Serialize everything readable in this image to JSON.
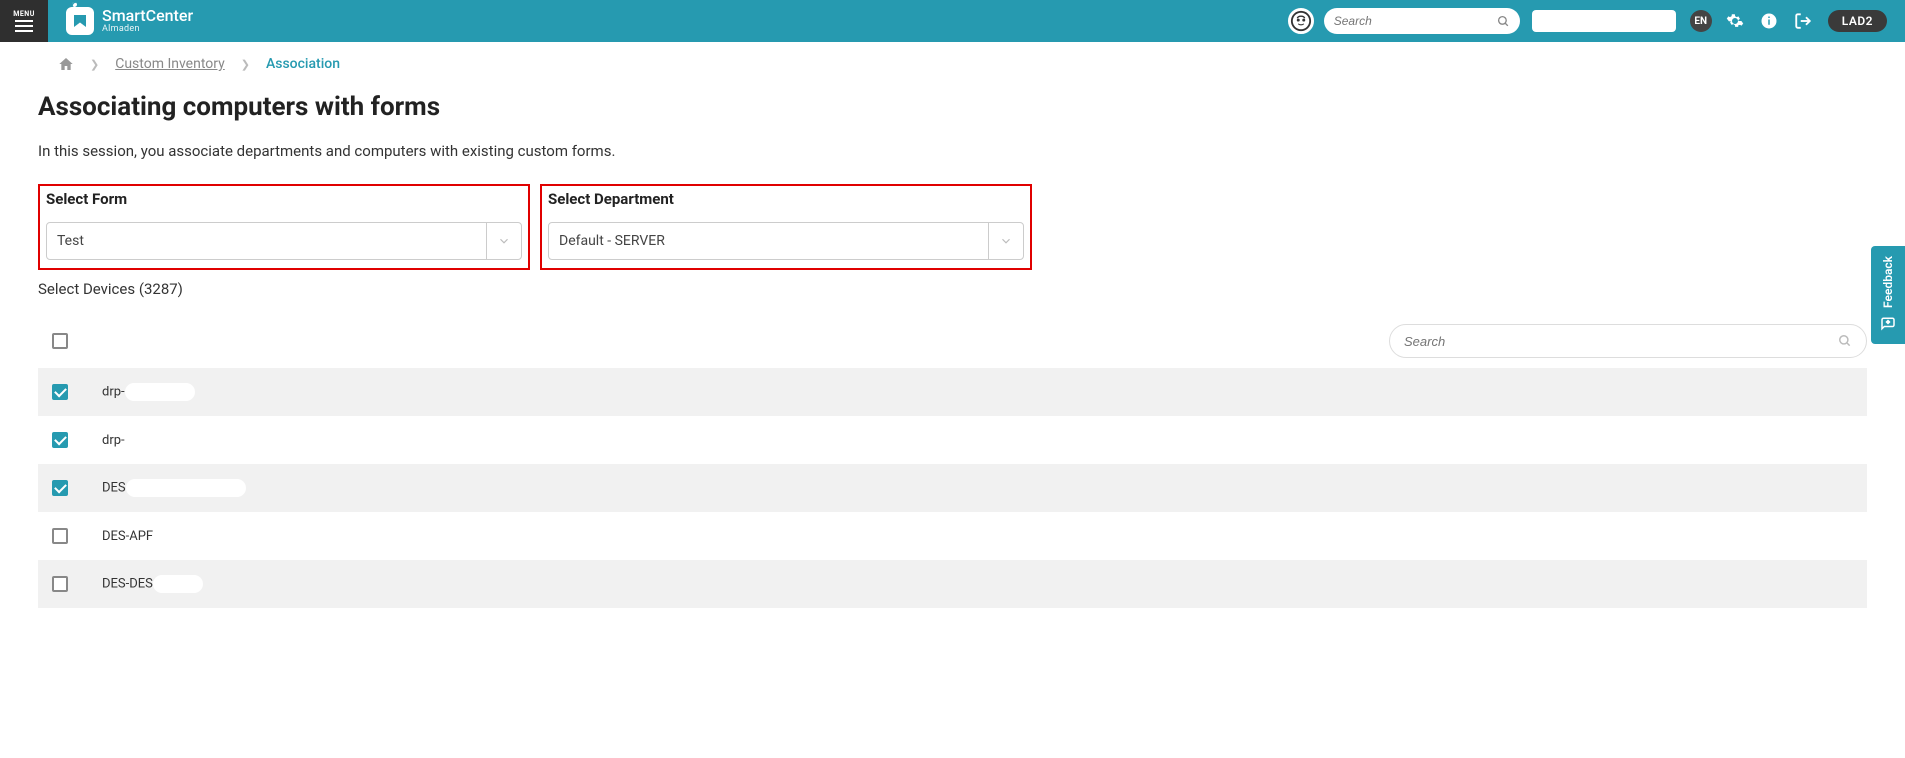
{
  "header": {
    "menu_label": "MENU",
    "brand_title": "SmartCenter",
    "brand_sub": "Almaden",
    "search_placeholder": "Search",
    "lang": "EN",
    "env": "LAD2"
  },
  "crumbs": {
    "custom_inventory": "Custom Inventory",
    "association": "Association"
  },
  "page": {
    "title": "Associating computers with forms",
    "desc": "In this session, you associate departments and computers with existing custom forms.",
    "select_form_label": "Select Form",
    "select_form_value": "Test",
    "select_dept_label": "Select Department",
    "select_dept_value": "Default - SERVER",
    "devices_label": "Select Devices (3287)",
    "table_search_placeholder": "Search"
  },
  "rows": [
    {
      "checked": true,
      "name": "drp-"
    },
    {
      "checked": true,
      "name": "drp-"
    },
    {
      "checked": true,
      "name": "DES"
    },
    {
      "checked": false,
      "name": "DES-APF"
    },
    {
      "checked": false,
      "name": "DES-DES"
    }
  ],
  "feedback": {
    "label": "Feedback"
  }
}
